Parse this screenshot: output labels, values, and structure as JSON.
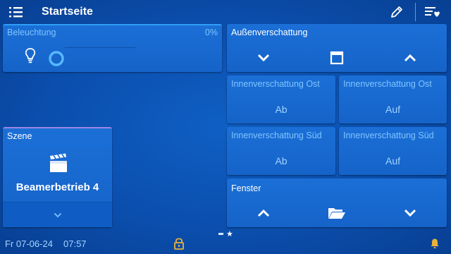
{
  "header": {
    "title": "Startseite",
    "menu_icon": "list-menu-icon",
    "edit_icon": "pencil-icon",
    "favorites_icon": "favorites-list-icon"
  },
  "beleuchtung": {
    "title": "Beleuchtung",
    "percent": "0%",
    "level": 0,
    "bulb_icon": "lightbulb-icon",
    "toggle_icon": "circle-toggle-icon"
  },
  "aussen": {
    "title": "Außenverschattung",
    "down_icon": "chevron-down-icon",
    "stop_icon": "stop-square-icon",
    "up_icon": "chevron-up-icon"
  },
  "innen": [
    {
      "title": "Innenverschattung Ost",
      "action": "Ab"
    },
    {
      "title": "Innenverschattung Ost",
      "action": "Auf"
    },
    {
      "title": "Innenverschattung Süd",
      "action": "Ab"
    },
    {
      "title": "Innenverschattung Süd",
      "action": "Auf"
    }
  ],
  "szene": {
    "title": "Szene",
    "icon": "clapperboard-icon",
    "name": "Beamerbetrieb 4",
    "expand_icon": "chevron-down-icon"
  },
  "fenster": {
    "title": "Fenster",
    "up_icon": "chevron-up-icon",
    "folder_icon": "open-folder-icon",
    "down_icon": "chevron-down-icon"
  },
  "footer": {
    "date": "Fr 07-06-24",
    "time": "07:57",
    "lock_icon": "padlock-icon",
    "bell_icon": "bell-icon",
    "page_star": "★"
  },
  "colors": {
    "background": "#0b4fae",
    "tile": "#1765cd",
    "accent": "#7fc4ff",
    "active_outline": "#2b9bf0"
  }
}
